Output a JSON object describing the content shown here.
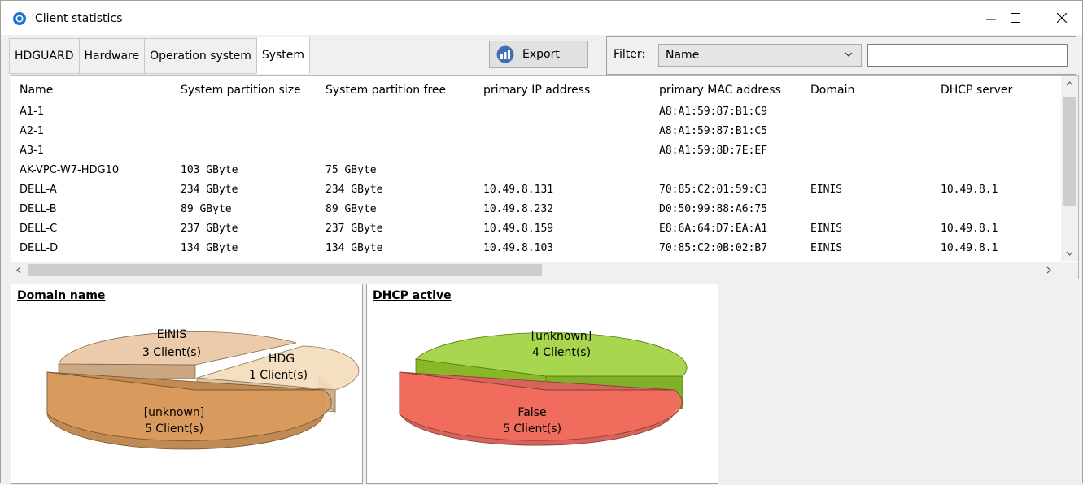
{
  "window": {
    "title": "Client statistics",
    "controls": {
      "minimize": "minimize",
      "maximize": "maximize",
      "close": "close"
    }
  },
  "tabs": [
    {
      "label": "HDGUARD",
      "active": false
    },
    {
      "label": "Hardware",
      "active": false
    },
    {
      "label": "Operation system",
      "active": false
    },
    {
      "label": "System",
      "active": true
    }
  ],
  "export_button": {
    "label": "Export",
    "icon": "export-icon"
  },
  "filter": {
    "label": "Filter:",
    "selected": "Name",
    "value": ""
  },
  "table": {
    "columns": [
      "Name",
      "System partition size",
      "System partition free",
      "primary IP address",
      "primary MAC address",
      "Domain",
      "DHCP server"
    ],
    "rows": [
      [
        "A1-1",
        "",
        "",
        "",
        "A8:A1:59:87:B1:C9",
        "",
        ""
      ],
      [
        "A2-1",
        "",
        "",
        "",
        "A8:A1:59:87:B1:C5",
        "",
        ""
      ],
      [
        "A3-1",
        "",
        "",
        "",
        "A8:A1:59:8D:7E:EF",
        "",
        ""
      ],
      [
        "AK-VPC-W7-HDG10",
        "103 GByte",
        "75 GByte",
        "",
        "",
        "",
        ""
      ],
      [
        "DELL-A",
        "234 GByte",
        "234 GByte",
        "10.49.8.131",
        "70:85:C2:01:59:C3",
        "EINIS",
        "10.49.8.1"
      ],
      [
        "DELL-B",
        "89 GByte",
        "89 GByte",
        "10.49.8.232",
        "D0:50:99:88:A6:75",
        "",
        ""
      ],
      [
        "DELL-C",
        "237 GByte",
        "237 GByte",
        "10.49.8.159",
        "E8:6A:64:D7:EA:A1",
        "EINIS",
        "10.49.8.1"
      ],
      [
        "DELL-D",
        "134 GByte",
        "134 GByte",
        "10.49.8.103",
        "70:85:C2:0B:02:B7",
        "EINIS",
        "10.49.8.1"
      ]
    ]
  },
  "charts": {
    "domain": {
      "title": "Domain name",
      "slices": [
        {
          "label": "EINIS",
          "count": "3 Client(s)"
        },
        {
          "label": "HDG",
          "count": "1 Client(s)"
        },
        {
          "label": "[unknown]",
          "count": "5 Client(s)"
        }
      ]
    },
    "dhcp": {
      "title": "DHCP active",
      "slices": [
        {
          "label": "[unknown]",
          "count": "4 Client(s)"
        },
        {
          "label": "False",
          "count": "5 Client(s)"
        }
      ]
    }
  },
  "chart_data": [
    {
      "type": "pie",
      "title": "Domain name",
      "categories": [
        "EINIS",
        "HDG",
        "[unknown]"
      ],
      "values": [
        3,
        1,
        5
      ],
      "colors": [
        "#e8c29e",
        "#f3dcbc",
        "#d69a5c"
      ]
    },
    {
      "type": "pie",
      "title": "DHCP active",
      "categories": [
        "[unknown]",
        "False"
      ],
      "values": [
        4,
        5
      ],
      "colors": [
        "#9acd32",
        "#f06a5a"
      ]
    }
  ],
  "colors": {
    "window_bg": "#f0f0f0",
    "title_icon": "#1e73d2",
    "einis": "#e8c29e",
    "hdg": "#f3dcbc",
    "unknown_domain": "#d69a5c",
    "unknown_dhcp": "#9acd32",
    "false_dhcp": "#f06a5a"
  }
}
